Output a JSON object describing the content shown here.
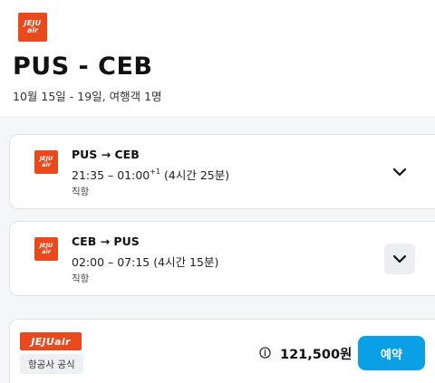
{
  "brand": {
    "logo_line1": "JEJU",
    "logo_line2": "air",
    "wide_logo": "JEJUair",
    "color": "#e8491d"
  },
  "header": {
    "route_title": "PUS - CEB",
    "trip_meta": "10월 15일 - 19일, 여행객 1명"
  },
  "legs": [
    {
      "route": "PUS → CEB",
      "time": "21:35 – 01:00",
      "day_offset": "+1",
      "duration": "(4시간 25분)",
      "stops": "직항",
      "icon": "chevron-down-icon"
    },
    {
      "route": "CEB → PUS",
      "time": "02:00 – 07:15",
      "day_offset": "",
      "duration": "(4시간 15분)",
      "stops": "직항",
      "icon": "chevron-down-icon"
    }
  ],
  "deal": {
    "badge": "항공사 공식",
    "info_icon": "info-icon",
    "price": "121,500원",
    "book_label": "예약",
    "book_color": "#0aa0e6"
  }
}
